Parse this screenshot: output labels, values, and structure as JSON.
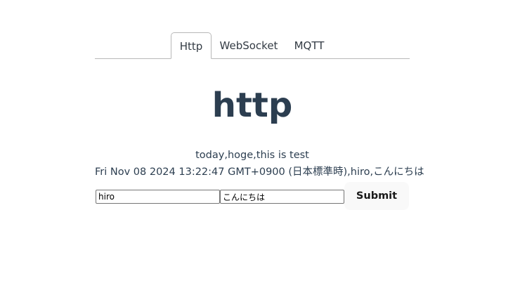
{
  "tabs": [
    {
      "label": "Http",
      "active": true
    },
    {
      "label": "WebSocket",
      "active": false
    },
    {
      "label": "MQTT",
      "active": false
    }
  ],
  "main": {
    "title": "http",
    "response_line": "today,hoge,this is test",
    "result_line": "Fri Nov 08 2024 13:22:47 GMT+0900 (日本標準時),hiro,こんにちは"
  },
  "form": {
    "name_value": "hiro",
    "message_value": "こんにちは",
    "submit_label": "Submit"
  },
  "colors": {
    "text": "#2c3e50",
    "tab_border": "#b8b8b8",
    "button_bg": "#f9f9f9"
  }
}
